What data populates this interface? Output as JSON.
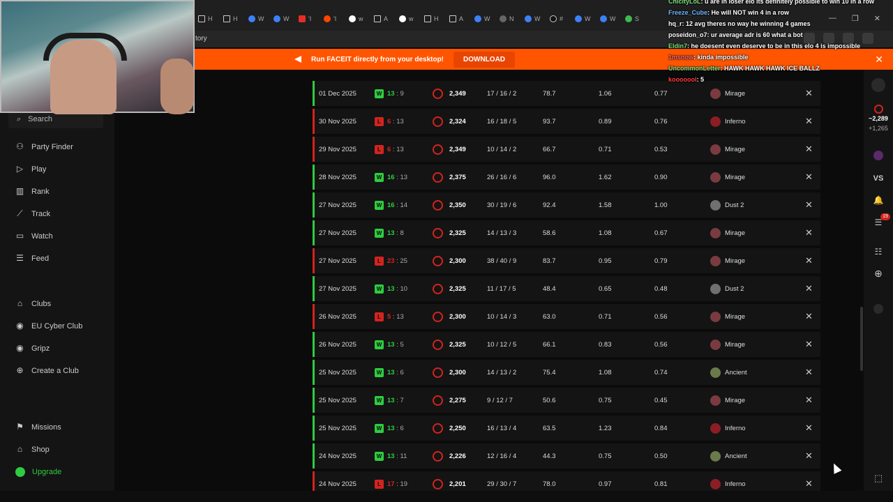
{
  "browser": {
    "tabs": [
      {
        "icon": "x-icon",
        "label": "H"
      },
      {
        "icon": "x-icon",
        "label": "H"
      },
      {
        "icon": "globe-icon",
        "label": "W"
      },
      {
        "icon": "globe-icon",
        "label": "W"
      },
      {
        "icon": "youtube-icon",
        "label": "'I"
      },
      {
        "icon": "reddit-icon",
        "label": "'I"
      },
      {
        "icon": "google-icon",
        "label": "w"
      },
      {
        "icon": "x-icon",
        "label": "A"
      },
      {
        "icon": "google-icon",
        "label": "w"
      },
      {
        "icon": "x-icon",
        "label": "H"
      },
      {
        "icon": "x-icon",
        "label": "A"
      },
      {
        "icon": "globe-icon",
        "label": "W"
      },
      {
        "icon": "link-icon",
        "label": "N"
      },
      {
        "icon": "globe-icon",
        "label": "W"
      },
      {
        "icon": "tiktok-icon",
        "label": "#"
      },
      {
        "icon": "globe-icon",
        "label": "W"
      },
      {
        "icon": "globe-icon",
        "label": "W"
      },
      {
        "icon": "game-icon",
        "label": "S"
      }
    ],
    "address_text": "tory",
    "window_controls": [
      "—",
      "❐",
      "✕"
    ]
  },
  "banner": {
    "text": "Run FACEIT directly from your desktop!",
    "button": "DOWNLOAD"
  },
  "sidebar": {
    "search_placeholder": "Search",
    "items": [
      {
        "label": "Party Finder",
        "icon": "users-icon"
      },
      {
        "label": "Play",
        "icon": "play-icon"
      },
      {
        "label": "Rank",
        "icon": "rank-icon"
      },
      {
        "label": "Track",
        "icon": "track-icon"
      },
      {
        "label": "Watch",
        "icon": "watch-icon"
      },
      {
        "label": "Feed",
        "icon": "feed-icon"
      }
    ],
    "clubs": [
      {
        "label": "Clubs",
        "icon": "clubs-icon"
      },
      {
        "label": "EU Cyber Club",
        "icon": "club-logo-icon"
      },
      {
        "label": "Gripz",
        "icon": "club-logo-icon"
      },
      {
        "label": "Create a Club",
        "icon": "plus-circle-icon"
      }
    ],
    "bottom": [
      {
        "label": "Missions",
        "icon": "missions-icon"
      },
      {
        "label": "Shop",
        "icon": "shop-icon"
      },
      {
        "label": "Upgrade",
        "icon": "upgrade-icon"
      }
    ]
  },
  "chat": [
    {
      "user": "ChicityLoL",
      "user_color": "#7fe07f",
      "message": ": u are in loser elo its definitely possible to win 10 in a row"
    },
    {
      "user": "Freeze_Cube",
      "user_color": "#6fb7ff",
      "message": ": He will NOT win 4 in a row"
    },
    {
      "user": "hq_r",
      "user_color": "#ffffff",
      "message": ": 12 avg theres no way he winning 4 games"
    },
    {
      "user": "poseidon_o7",
      "user_color": "#ffffff",
      "message": ": ur average adr is 60 what a bot"
    },
    {
      "user": "Eldin7",
      "user_color": "#7fe07f",
      "message": ": he doesent even deserve to be in this elo 4 is impossible"
    },
    {
      "user": "1msnow",
      "user_color": "#ff6b6b",
      "message": ": kinda impossible"
    },
    {
      "user": "UncommonLetter",
      "user_color": "#7fe07f",
      "message": ": HAWK HAWK HAWK ICE BALLZ"
    },
    {
      "user": "kooooool",
      "user_color": "#ff3b3b",
      "message": ": 5"
    }
  ],
  "matches": [
    {
      "date": "01 Dec 2025",
      "result": "W",
      "score_a": "13",
      "score_b": "9",
      "elo": "2,349",
      "kda": "17 / 16 / 2",
      "adr": "78.7",
      "kd": "1.06",
      "kr": "0.77",
      "map": "Mirage"
    },
    {
      "date": "30 Nov 2025",
      "result": "L",
      "score_a": "6",
      "score_b": "13",
      "elo": "2,324",
      "kda": "16 / 18 / 5",
      "adr": "93.7",
      "kd": "0.89",
      "kr": "0.76",
      "map": "Inferno"
    },
    {
      "date": "29 Nov 2025",
      "result": "L",
      "score_a": "6",
      "score_b": "13",
      "elo": "2,349",
      "kda": "10 / 14 / 2",
      "adr": "66.7",
      "kd": "0.71",
      "kr": "0.53",
      "map": "Mirage"
    },
    {
      "date": "28 Nov 2025",
      "result": "W",
      "score_a": "16",
      "score_b": "13",
      "elo": "2,375",
      "kda": "26 / 16 / 6",
      "adr": "96.0",
      "kd": "1.62",
      "kr": "0.90",
      "map": "Mirage"
    },
    {
      "date": "27 Nov 2025",
      "result": "W",
      "score_a": "16",
      "score_b": "14",
      "elo": "2,350",
      "kda": "30 / 19 / 6",
      "adr": "92.4",
      "kd": "1.58",
      "kr": "1.00",
      "map": "Dust 2"
    },
    {
      "date": "27 Nov 2025",
      "result": "W",
      "score_a": "13",
      "score_b": "8",
      "elo": "2,325",
      "kda": "14 / 13 / 3",
      "adr": "58.6",
      "kd": "1.08",
      "kr": "0.67",
      "map": "Mirage"
    },
    {
      "date": "27 Nov 2025",
      "result": "L",
      "score_a": "23",
      "score_b": "25",
      "elo": "2,300",
      "kda": "38 / 40 / 9",
      "adr": "83.7",
      "kd": "0.95",
      "kr": "0.79",
      "map": "Mirage"
    },
    {
      "date": "27 Nov 2025",
      "result": "W",
      "score_a": "13",
      "score_b": "10",
      "elo": "2,325",
      "kda": "11 / 17 / 5",
      "adr": "48.4",
      "kd": "0.65",
      "kr": "0.48",
      "map": "Dust 2"
    },
    {
      "date": "26 Nov 2025",
      "result": "L",
      "score_a": "5",
      "score_b": "13",
      "elo": "2,300",
      "kda": "10 / 14 / 3",
      "adr": "63.0",
      "kd": "0.71",
      "kr": "0.56",
      "map": "Mirage"
    },
    {
      "date": "26 Nov 2025",
      "result": "W",
      "score_a": "13",
      "score_b": "5",
      "elo": "2,325",
      "kda": "10 / 12 / 5",
      "adr": "66.1",
      "kd": "0.83",
      "kr": "0.56",
      "map": "Mirage"
    },
    {
      "date": "25 Nov 2025",
      "result": "W",
      "score_a": "13",
      "score_b": "6",
      "elo": "2,300",
      "kda": "14 / 13 / 2",
      "adr": "75.4",
      "kd": "1.08",
      "kr": "0.74",
      "map": "Ancient"
    },
    {
      "date": "25 Nov 2025",
      "result": "W",
      "score_a": "13",
      "score_b": "7",
      "elo": "2,275",
      "kda": "9 / 12 / 7",
      "adr": "50.6",
      "kd": "0.75",
      "kr": "0.45",
      "map": "Mirage"
    },
    {
      "date": "25 Nov 2025",
      "result": "W",
      "score_a": "13",
      "score_b": "6",
      "elo": "2,250",
      "kda": "16 / 13 / 4",
      "adr": "63.5",
      "kd": "1.23",
      "kr": "0.84",
      "map": "Inferno"
    },
    {
      "date": "24 Nov 2025",
      "result": "W",
      "score_a": "13",
      "score_b": "11",
      "elo": "2,226",
      "kda": "12 / 16 / 4",
      "adr": "44.3",
      "kd": "0.75",
      "kr": "0.50",
      "map": "Ancient"
    },
    {
      "date": "24 Nov 2025",
      "result": "L",
      "score_a": "17",
      "score_b": "19",
      "elo": "2,201",
      "kda": "29 / 30 / 7",
      "adr": "78.0",
      "kd": "0.97",
      "kr": "0.81",
      "map": "Inferno"
    }
  ],
  "rail": {
    "elo_value": "~2,289",
    "elo_delta": "+1,265",
    "vs_label": "VS",
    "friends_badge": "19"
  },
  "colors": {
    "win": "#2ecc40",
    "loss": "#d3241e",
    "accent": "#ff5500",
    "map_mirage": "#7a3b40",
    "map_inferno": "#8b1e24",
    "map_dust2": "#707070",
    "map_ancient": "#6b7a4a"
  }
}
